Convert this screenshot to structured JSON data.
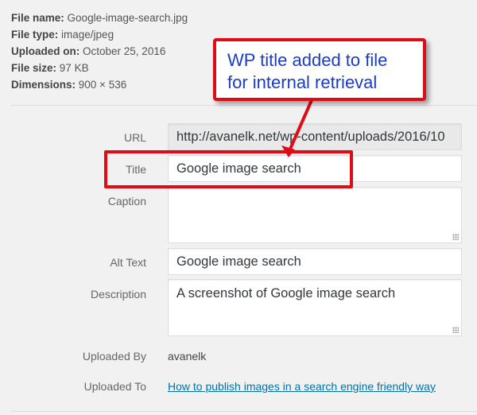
{
  "file_meta": {
    "name_label": "File name:",
    "name_value": "Google-image-search.jpg",
    "type_label": "File type:",
    "type_value": "image/jpeg",
    "uploaded_label": "Uploaded on:",
    "uploaded_value": "October 25, 2016",
    "size_label": "File size:",
    "size_value": "97 KB",
    "dimensions_label": "Dimensions:",
    "dimensions_value": "900 × 536"
  },
  "fields": {
    "url_label": "URL",
    "url_value": "http://avanelk.net/wp-content/uploads/2016/10",
    "title_label": "Title",
    "title_value": "Google image search",
    "caption_label": "Caption",
    "caption_value": "",
    "alt_label": "Alt Text",
    "alt_value": "Google image search",
    "description_label": "Description",
    "description_value": "A screenshot of Google image search",
    "uploaded_by_label": "Uploaded By",
    "uploaded_by_value": "avanelk",
    "uploaded_to_label": "Uploaded To",
    "uploaded_to_value": "How to publish images in a search engine friendly way"
  },
  "annotation": {
    "line1": "WP title added to file",
    "line2": "for internal retrieval",
    "color": "#e00b14",
    "text_color": "#1a3cc8"
  }
}
